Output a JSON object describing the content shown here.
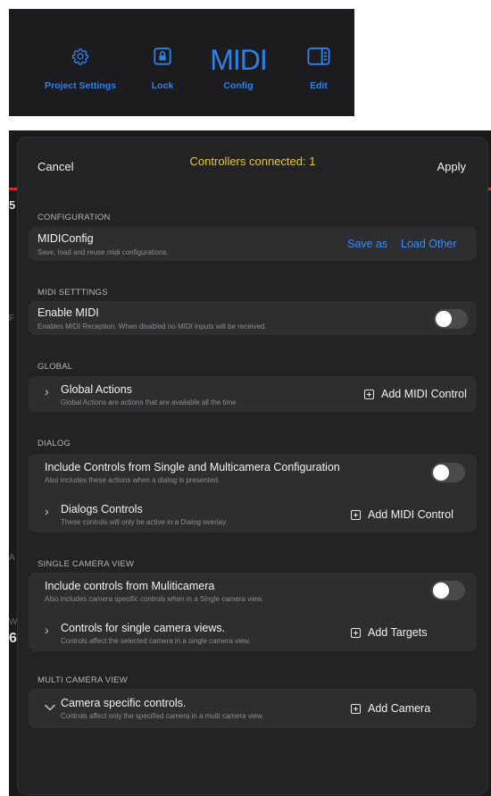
{
  "toolbar": {
    "items": [
      {
        "label": "Project Settings",
        "icon": "gear-icon"
      },
      {
        "label": "Lock",
        "icon": "lock-icon"
      },
      {
        "label": "Config",
        "icon_text": "MIDI"
      },
      {
        "label": "Edit",
        "icon": "edit-panel-icon"
      }
    ],
    "accent": "#2f80ed"
  },
  "background_app": {
    "fragments": [
      "5",
      "F",
      "W",
      "6!",
      "A"
    ]
  },
  "modal": {
    "cancel": "Cancel",
    "status": "Controllers connected: 1",
    "apply": "Apply",
    "sections": {
      "configuration": {
        "title": "CONFIGURATION",
        "row": {
          "title": "MIDIConfig",
          "subtitle": "Save, load and reuse midi configurations.",
          "save_as": "Save as",
          "load_other": "Load Other"
        }
      },
      "midi_settings": {
        "title": "MIDI SETTTINGS",
        "row": {
          "title": "Enable MIDI",
          "subtitle": "Enables MIDI Reception. When disabled no MIDI inputs will be received.",
          "toggle_on": false
        }
      },
      "global": {
        "title": "GLOBAL",
        "row": {
          "title": "Global Actions",
          "subtitle": "Global Actions are actions that are available all the time",
          "action": "Add MIDI Control"
        }
      },
      "dialog": {
        "title": "DIALOG",
        "include": {
          "title": "Include Controls from Single and Multicamera Configuration",
          "subtitle": "Also includes these actions when a dialog is presented.",
          "toggle_on": false
        },
        "controls": {
          "title": "Dialogs Controls",
          "subtitle": "These controls will only be active in a Dialog overlay.",
          "action": "Add MIDI Control"
        }
      },
      "single_camera": {
        "title": "SINGLE CAMERA VIEW",
        "include": {
          "title": "Include controls from Muliticamera",
          "subtitle": "Also includes camera specific controls when in a Single camera view.",
          "toggle_on": false
        },
        "controls": {
          "title": "Controls for single camera views.",
          "subtitle": "Controls affect the selected camera in a single camera view.",
          "action": "Add Targets"
        }
      },
      "multi_camera": {
        "title": "MULTI CAMERA VIEW",
        "row": {
          "title": "Camera specific controls.",
          "subtitle": "Controls affect only the specified camera in a multi camera view.",
          "action": "Add Camera"
        }
      }
    },
    "colors": {
      "status": "#e6c642",
      "link": "#3d8bf5",
      "card": "#2e2e30",
      "sheet": "#232325"
    }
  }
}
